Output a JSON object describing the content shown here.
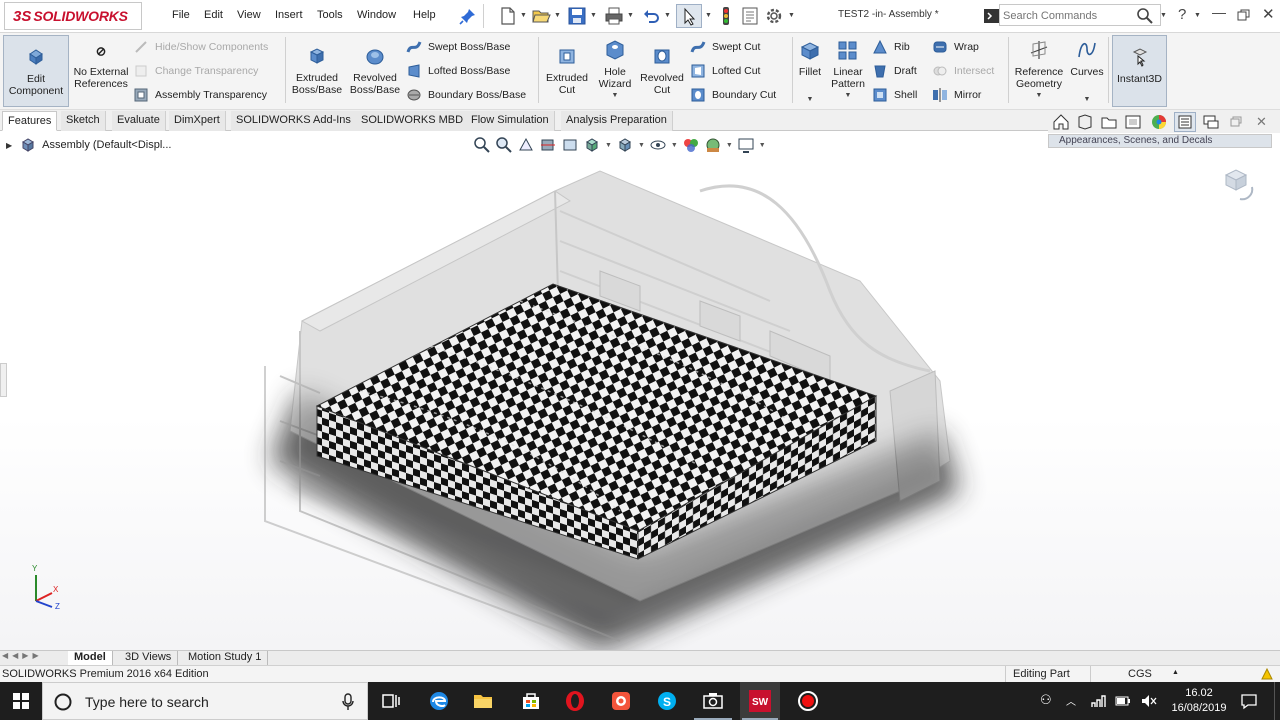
{
  "app": {
    "brand": "SOLIDWORKS",
    "document_title": "TEST2 -in- Assembly *"
  },
  "menu": [
    "File",
    "Edit",
    "View",
    "Insert",
    "Tools",
    "Window",
    "Help"
  ],
  "search": {
    "placeholder": "Search Commands"
  },
  "ribbon": {
    "edit_component": "Edit Component",
    "no_external_references": "No External References",
    "hide_show_components": "Hide/Show Components",
    "change_transparency": "Change Transparency",
    "assembly_transparency": "Assembly Transparency",
    "extruded_boss": "Extruded Boss/Base",
    "revolved_boss": "Revolved Boss/Base",
    "swept_boss": "Swept Boss/Base",
    "lofted_boss": "Lofted Boss/Base",
    "boundary_boss": "Boundary Boss/Base",
    "extruded_cut": "Extruded Cut",
    "hole_wizard": "Hole Wizard",
    "revolved_cut": "Revolved Cut",
    "swept_cut": "Swept Cut",
    "lofted_cut": "Lofted Cut",
    "boundary_cut": "Boundary Cut",
    "fillet": "Fillet",
    "linear_pattern": "Linear Pattern",
    "rib": "Rib",
    "draft": "Draft",
    "shell": "Shell",
    "wrap": "Wrap",
    "intersect": "Intersect",
    "mirror": "Mirror",
    "reference_geometry": "Reference Geometry",
    "curves": "Curves",
    "instant3d": "Instant3D"
  },
  "command_tabs": [
    "Features",
    "Sketch",
    "Evaluate",
    "DimXpert",
    "SOLIDWORKS Add-Ins",
    "SOLIDWORKS MBD",
    "Flow Simulation",
    "Analysis Preparation"
  ],
  "feature_tree": {
    "root": "Assembly  (Default<Displ..."
  },
  "task_pane": {
    "title": "Appearances, Scenes, and Decals"
  },
  "bottom_tabs": [
    "Model",
    "3D Views",
    "Motion Study 1"
  ],
  "status": {
    "edition": "SOLIDWORKS Premium 2016 x64 Edition",
    "mode": "Editing Part",
    "units": "CGS"
  },
  "taskbar": {
    "search_placeholder": "Type here to search",
    "time": "16.02",
    "date": "16/08/2019"
  },
  "triad": {
    "x": "X",
    "y": "Y",
    "z": "Z"
  },
  "colors": {
    "brand_red": "#c8102e",
    "taskbar": "#1e1e1e"
  }
}
